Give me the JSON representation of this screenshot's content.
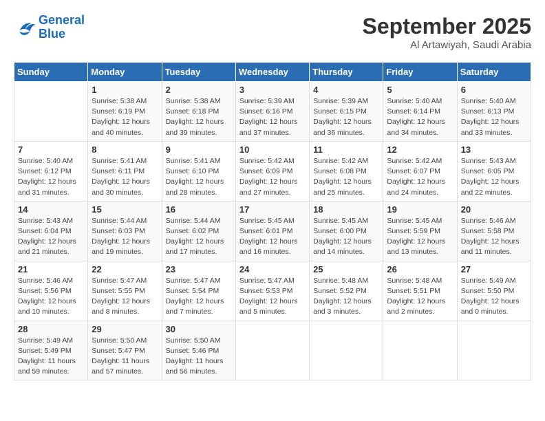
{
  "header": {
    "logo_line1": "General",
    "logo_line2": "Blue",
    "month": "September 2025",
    "location": "Al Artawiyah, Saudi Arabia"
  },
  "days_of_week": [
    "Sunday",
    "Monday",
    "Tuesday",
    "Wednesday",
    "Thursday",
    "Friday",
    "Saturday"
  ],
  "weeks": [
    [
      {
        "num": "",
        "info": ""
      },
      {
        "num": "1",
        "info": "Sunrise: 5:38 AM\nSunset: 6:19 PM\nDaylight: 12 hours\nand 40 minutes."
      },
      {
        "num": "2",
        "info": "Sunrise: 5:38 AM\nSunset: 6:18 PM\nDaylight: 12 hours\nand 39 minutes."
      },
      {
        "num": "3",
        "info": "Sunrise: 5:39 AM\nSunset: 6:16 PM\nDaylight: 12 hours\nand 37 minutes."
      },
      {
        "num": "4",
        "info": "Sunrise: 5:39 AM\nSunset: 6:15 PM\nDaylight: 12 hours\nand 36 minutes."
      },
      {
        "num": "5",
        "info": "Sunrise: 5:40 AM\nSunset: 6:14 PM\nDaylight: 12 hours\nand 34 minutes."
      },
      {
        "num": "6",
        "info": "Sunrise: 5:40 AM\nSunset: 6:13 PM\nDaylight: 12 hours\nand 33 minutes."
      }
    ],
    [
      {
        "num": "7",
        "info": "Sunrise: 5:40 AM\nSunset: 6:12 PM\nDaylight: 12 hours\nand 31 minutes."
      },
      {
        "num": "8",
        "info": "Sunrise: 5:41 AM\nSunset: 6:11 PM\nDaylight: 12 hours\nand 30 minutes."
      },
      {
        "num": "9",
        "info": "Sunrise: 5:41 AM\nSunset: 6:10 PM\nDaylight: 12 hours\nand 28 minutes."
      },
      {
        "num": "10",
        "info": "Sunrise: 5:42 AM\nSunset: 6:09 PM\nDaylight: 12 hours\nand 27 minutes."
      },
      {
        "num": "11",
        "info": "Sunrise: 5:42 AM\nSunset: 6:08 PM\nDaylight: 12 hours\nand 25 minutes."
      },
      {
        "num": "12",
        "info": "Sunrise: 5:42 AM\nSunset: 6:07 PM\nDaylight: 12 hours\nand 24 minutes."
      },
      {
        "num": "13",
        "info": "Sunrise: 5:43 AM\nSunset: 6:05 PM\nDaylight: 12 hours\nand 22 minutes."
      }
    ],
    [
      {
        "num": "14",
        "info": "Sunrise: 5:43 AM\nSunset: 6:04 PM\nDaylight: 12 hours\nand 21 minutes."
      },
      {
        "num": "15",
        "info": "Sunrise: 5:44 AM\nSunset: 6:03 PM\nDaylight: 12 hours\nand 19 minutes."
      },
      {
        "num": "16",
        "info": "Sunrise: 5:44 AM\nSunset: 6:02 PM\nDaylight: 12 hours\nand 17 minutes."
      },
      {
        "num": "17",
        "info": "Sunrise: 5:45 AM\nSunset: 6:01 PM\nDaylight: 12 hours\nand 16 minutes."
      },
      {
        "num": "18",
        "info": "Sunrise: 5:45 AM\nSunset: 6:00 PM\nDaylight: 12 hours\nand 14 minutes."
      },
      {
        "num": "19",
        "info": "Sunrise: 5:45 AM\nSunset: 5:59 PM\nDaylight: 12 hours\nand 13 minutes."
      },
      {
        "num": "20",
        "info": "Sunrise: 5:46 AM\nSunset: 5:58 PM\nDaylight: 12 hours\nand 11 minutes."
      }
    ],
    [
      {
        "num": "21",
        "info": "Sunrise: 5:46 AM\nSunset: 5:56 PM\nDaylight: 12 hours\nand 10 minutes."
      },
      {
        "num": "22",
        "info": "Sunrise: 5:47 AM\nSunset: 5:55 PM\nDaylight: 12 hours\nand 8 minutes."
      },
      {
        "num": "23",
        "info": "Sunrise: 5:47 AM\nSunset: 5:54 PM\nDaylight: 12 hours\nand 7 minutes."
      },
      {
        "num": "24",
        "info": "Sunrise: 5:47 AM\nSunset: 5:53 PM\nDaylight: 12 hours\nand 5 minutes."
      },
      {
        "num": "25",
        "info": "Sunrise: 5:48 AM\nSunset: 5:52 PM\nDaylight: 12 hours\nand 3 minutes."
      },
      {
        "num": "26",
        "info": "Sunrise: 5:48 AM\nSunset: 5:51 PM\nDaylight: 12 hours\nand 2 minutes."
      },
      {
        "num": "27",
        "info": "Sunrise: 5:49 AM\nSunset: 5:50 PM\nDaylight: 12 hours\nand 0 minutes."
      }
    ],
    [
      {
        "num": "28",
        "info": "Sunrise: 5:49 AM\nSunset: 5:49 PM\nDaylight: 11 hours\nand 59 minutes."
      },
      {
        "num": "29",
        "info": "Sunrise: 5:50 AM\nSunset: 5:47 PM\nDaylight: 11 hours\nand 57 minutes."
      },
      {
        "num": "30",
        "info": "Sunrise: 5:50 AM\nSunset: 5:46 PM\nDaylight: 11 hours\nand 56 minutes."
      },
      {
        "num": "",
        "info": ""
      },
      {
        "num": "",
        "info": ""
      },
      {
        "num": "",
        "info": ""
      },
      {
        "num": "",
        "info": ""
      }
    ]
  ]
}
